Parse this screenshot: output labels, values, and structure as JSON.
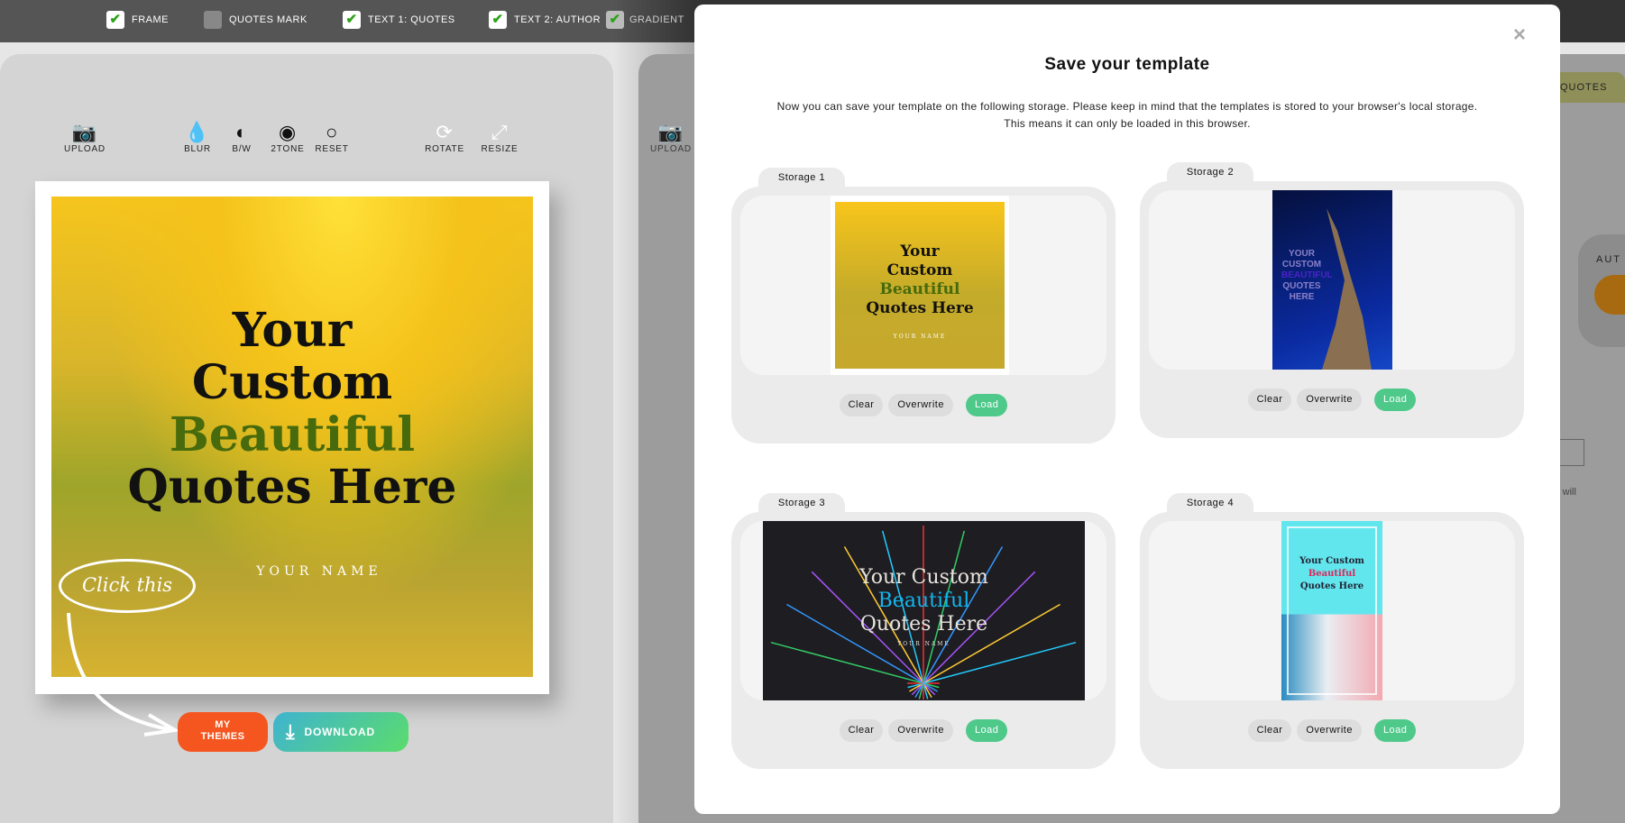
{
  "topbar": {
    "options": [
      {
        "label": "FRAME",
        "checked": true
      },
      {
        "label": "QUOTES MARK",
        "checked": false
      },
      {
        "label": "TEXT 1: QUOTES",
        "checked": true
      },
      {
        "label": "TEXT 2: AUTHOR",
        "checked": true
      },
      {
        "label": "GRADIENT",
        "checked": true
      }
    ]
  },
  "toolbar": {
    "upload": "UPLOAD",
    "blur": "BLUR",
    "bw": "B/W",
    "twotone": "2TONE",
    "reset": "RESET",
    "rotate": "ROTATE",
    "resize": "RESIZE"
  },
  "canvas": {
    "line1": "Your",
    "line2": "Custom",
    "line3": "Beautiful",
    "line4": "Quotes Here",
    "author": "YOUR NAME",
    "accent": "#466a0c"
  },
  "hint": "Click this",
  "actions": {
    "my_themes_1": "MY",
    "my_themes_2": "THEMES",
    "download": "DOWNLOAD",
    "themes_color": "#f5561f"
  },
  "background_panel": {
    "tab": "QUOTES",
    "upload": "UPLOAD",
    "author_label": "AUT",
    "text_fragment": "ve will"
  },
  "modal": {
    "title": "Save your template",
    "description_1": "Now you can save your template on the following storage. Please keep in mind that the templates is stored to your browser's local storage.",
    "description_2": "This means it can only be loaded in this browser.",
    "close": "×",
    "storages": [
      {
        "label": "Storage 1",
        "thumb": {
          "l1": "Your",
          "l2": "Custom",
          "l3": "Beautiful",
          "l4": "Quotes Here",
          "author": "YOUR NAME"
        }
      },
      {
        "label": "Storage 2",
        "thumb": {
          "l1": "YOUR",
          "l2": "CUSTOM",
          "l3": "BEAUTIFUL",
          "l4": "QUOTES",
          "l5": "HERE"
        }
      },
      {
        "label": "Storage 3",
        "thumb": {
          "l1": "Your Custom",
          "l2": "Beautiful",
          "l3": "Quotes Here",
          "author": "YOUR NAME"
        }
      },
      {
        "label": "Storage 4",
        "thumb": {
          "l1": "Your Custom",
          "l2": "Beautiful",
          "l3": "Quotes Here"
        }
      }
    ],
    "buttons": {
      "clear": "Clear",
      "overwrite": "Overwrite",
      "load": "Load"
    },
    "load_color": "#4ec98a"
  }
}
